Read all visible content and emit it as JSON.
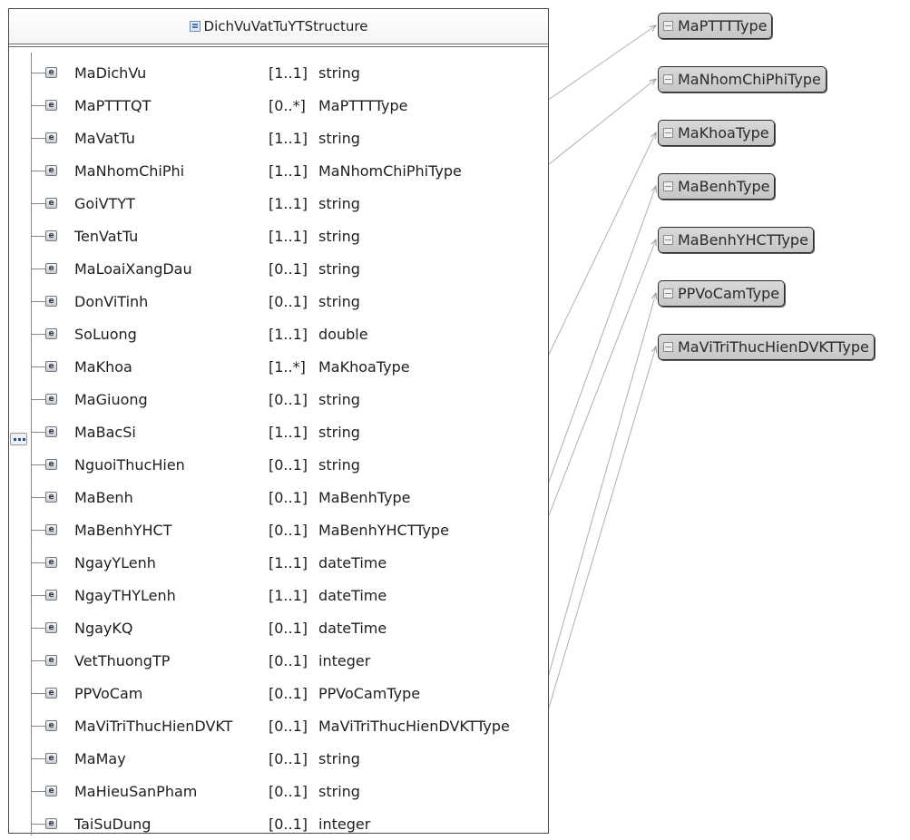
{
  "structure": {
    "title": "DichVuVatTuYTStructure",
    "icon": "complex-type-icon",
    "sequence_icon": "sequence-compositor-icon",
    "elements": [
      {
        "name": "MaDichVu",
        "cardinality": "[1..1]",
        "type": "string"
      },
      {
        "name": "MaPTTTQT",
        "cardinality": "[0..*]",
        "type": "MaPTTTType"
      },
      {
        "name": "MaVatTu",
        "cardinality": "[1..1]",
        "type": "string"
      },
      {
        "name": "MaNhomChiPhi",
        "cardinality": "[1..1]",
        "type": "MaNhomChiPhiType"
      },
      {
        "name": "GoiVTYT",
        "cardinality": "[1..1]",
        "type": "string"
      },
      {
        "name": "TenVatTu",
        "cardinality": "[1..1]",
        "type": "string"
      },
      {
        "name": "MaLoaiXangDau",
        "cardinality": "[0..1]",
        "type": "string"
      },
      {
        "name": "DonViTinh",
        "cardinality": "[0..1]",
        "type": "string"
      },
      {
        "name": "SoLuong",
        "cardinality": "[1..1]",
        "type": "double"
      },
      {
        "name": "MaKhoa",
        "cardinality": "[1..*]",
        "type": "MaKhoaType"
      },
      {
        "name": "MaGiuong",
        "cardinality": "[0..1]",
        "type": "string"
      },
      {
        "name": "MaBacSi",
        "cardinality": "[1..1]",
        "type": "string"
      },
      {
        "name": "NguoiThucHien",
        "cardinality": "[0..1]",
        "type": "string"
      },
      {
        "name": "MaBenh",
        "cardinality": "[0..1]",
        "type": "MaBenhType"
      },
      {
        "name": "MaBenhYHCT",
        "cardinality": "[0..1]",
        "type": "MaBenhYHCTType"
      },
      {
        "name": "NgayYLenh",
        "cardinality": "[1..1]",
        "type": "dateTime"
      },
      {
        "name": "NgayTHYLenh",
        "cardinality": "[1..1]",
        "type": "dateTime"
      },
      {
        "name": "NgayKQ",
        "cardinality": "[0..1]",
        "type": "dateTime"
      },
      {
        "name": "VetThuongTP",
        "cardinality": "[0..1]",
        "type": "integer"
      },
      {
        "name": "PPVoCam",
        "cardinality": "[0..1]",
        "type": "PPVoCamType"
      },
      {
        "name": "MaViTriThucHienDVKT",
        "cardinality": "[0..1]",
        "type": "MaViTriThucHienDVKTType"
      },
      {
        "name": "MaMay",
        "cardinality": "[0..1]",
        "type": "string"
      },
      {
        "name": "MaHieuSanPham",
        "cardinality": "[0..1]",
        "type": "string"
      },
      {
        "name": "TaiSuDung",
        "cardinality": "[0..1]",
        "type": "integer"
      }
    ]
  },
  "type_refs": [
    {
      "name": "MaPTTTType"
    },
    {
      "name": "MaNhomChiPhiType"
    },
    {
      "name": "MaKhoaType"
    },
    {
      "name": "MaBenhType"
    },
    {
      "name": "MaBenhYHCTType"
    },
    {
      "name": "PPVoCamType"
    },
    {
      "name": "MaViTriThucHienDVKTType"
    }
  ],
  "element_icon_letter": "e",
  "connections": [
    {
      "element": "MaPTTTQT",
      "type": "MaPTTTType"
    },
    {
      "element": "MaNhomChiPhi",
      "type": "MaNhomChiPhiType"
    },
    {
      "element": "MaKhoa",
      "type": "MaKhoaType"
    },
    {
      "element": "MaBenh",
      "type": "MaBenhType"
    },
    {
      "element": "MaBenhYHCT",
      "type": "MaBenhYHCTType"
    },
    {
      "element": "PPVoCam",
      "type": "PPVoCamType"
    },
    {
      "element": "MaViTriThucHienDVKT",
      "type": "MaViTriThucHienDVKTType"
    }
  ]
}
